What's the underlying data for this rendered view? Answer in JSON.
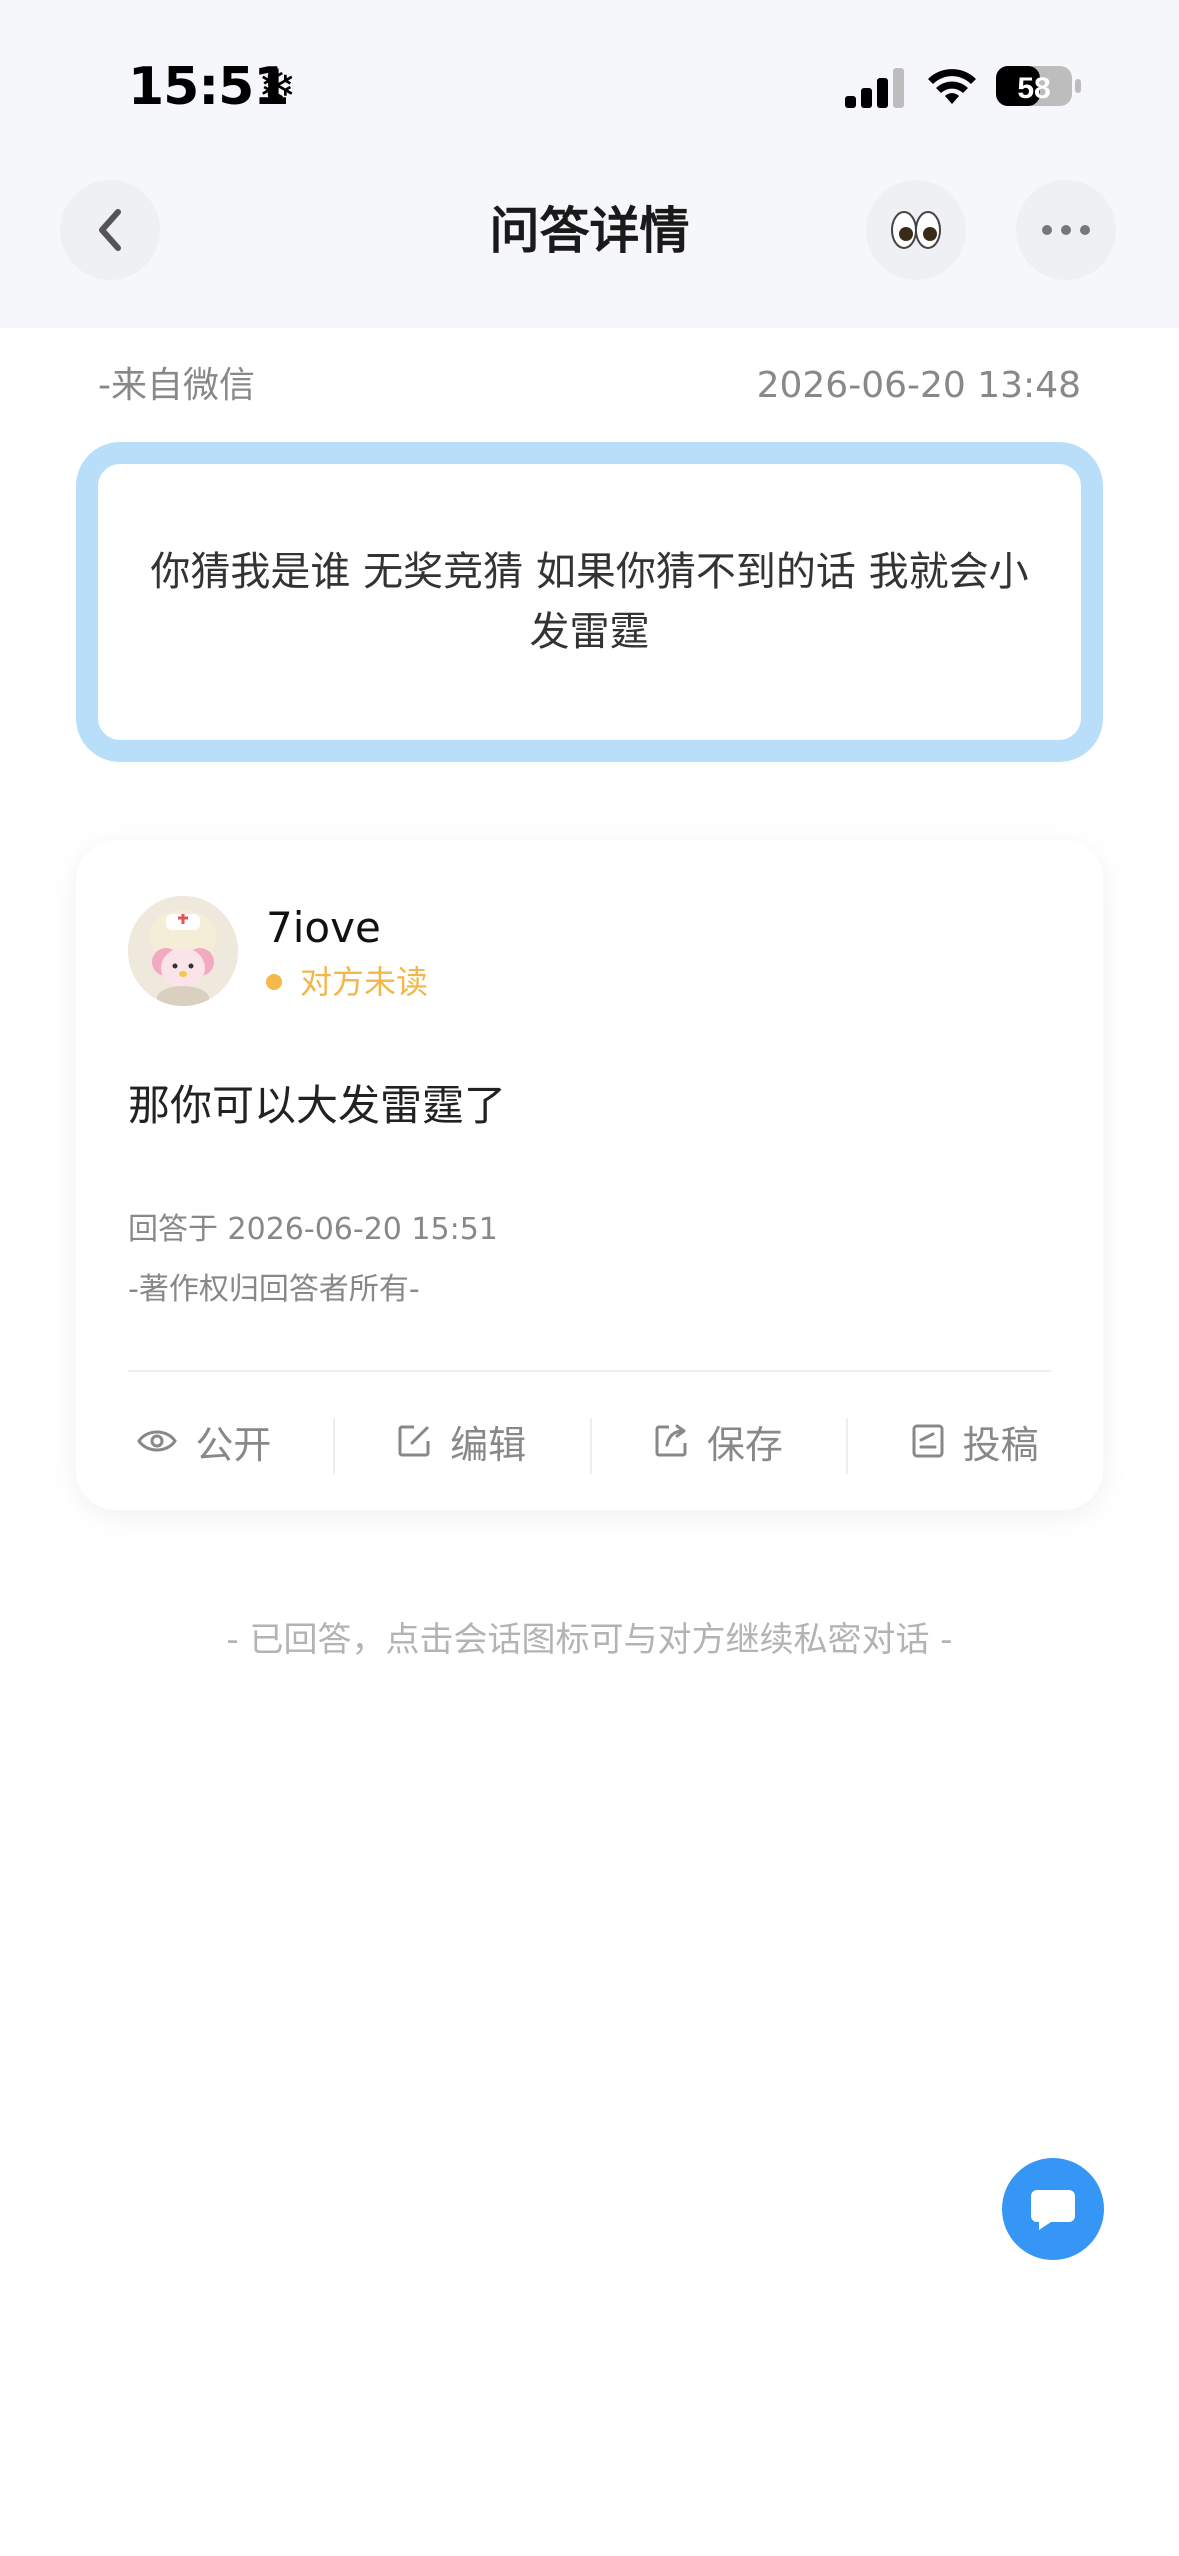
{
  "status_bar": {
    "time": "15:51",
    "battery": "58"
  },
  "nav": {
    "title": "问答详情"
  },
  "question": {
    "source": "-来自微信",
    "date": "2026-06-20 13:48",
    "text": "你猜我是谁 无奖竞猜 如果你猜不到的话 我就会小发雷霆"
  },
  "answer": {
    "username": "7iove",
    "read_status": "对方未读",
    "text": "那你可以大发雷霆了",
    "answered_at": "回答于 2026-06-20 15:51",
    "copyright": "-著作权归回答者所有-",
    "actions": [
      {
        "label": "公开",
        "icon": "eye-icon"
      },
      {
        "label": "编辑",
        "icon": "edit-icon"
      },
      {
        "label": "保存",
        "icon": "share-icon"
      },
      {
        "label": "投稿",
        "icon": "document-icon"
      }
    ]
  },
  "hint": "- 已回答，点击会话图标可与对方继续私密对话 -",
  "colors": {
    "accent": "#3696f5",
    "question_border": "#b8defa",
    "unread": "#f5b94a"
  }
}
